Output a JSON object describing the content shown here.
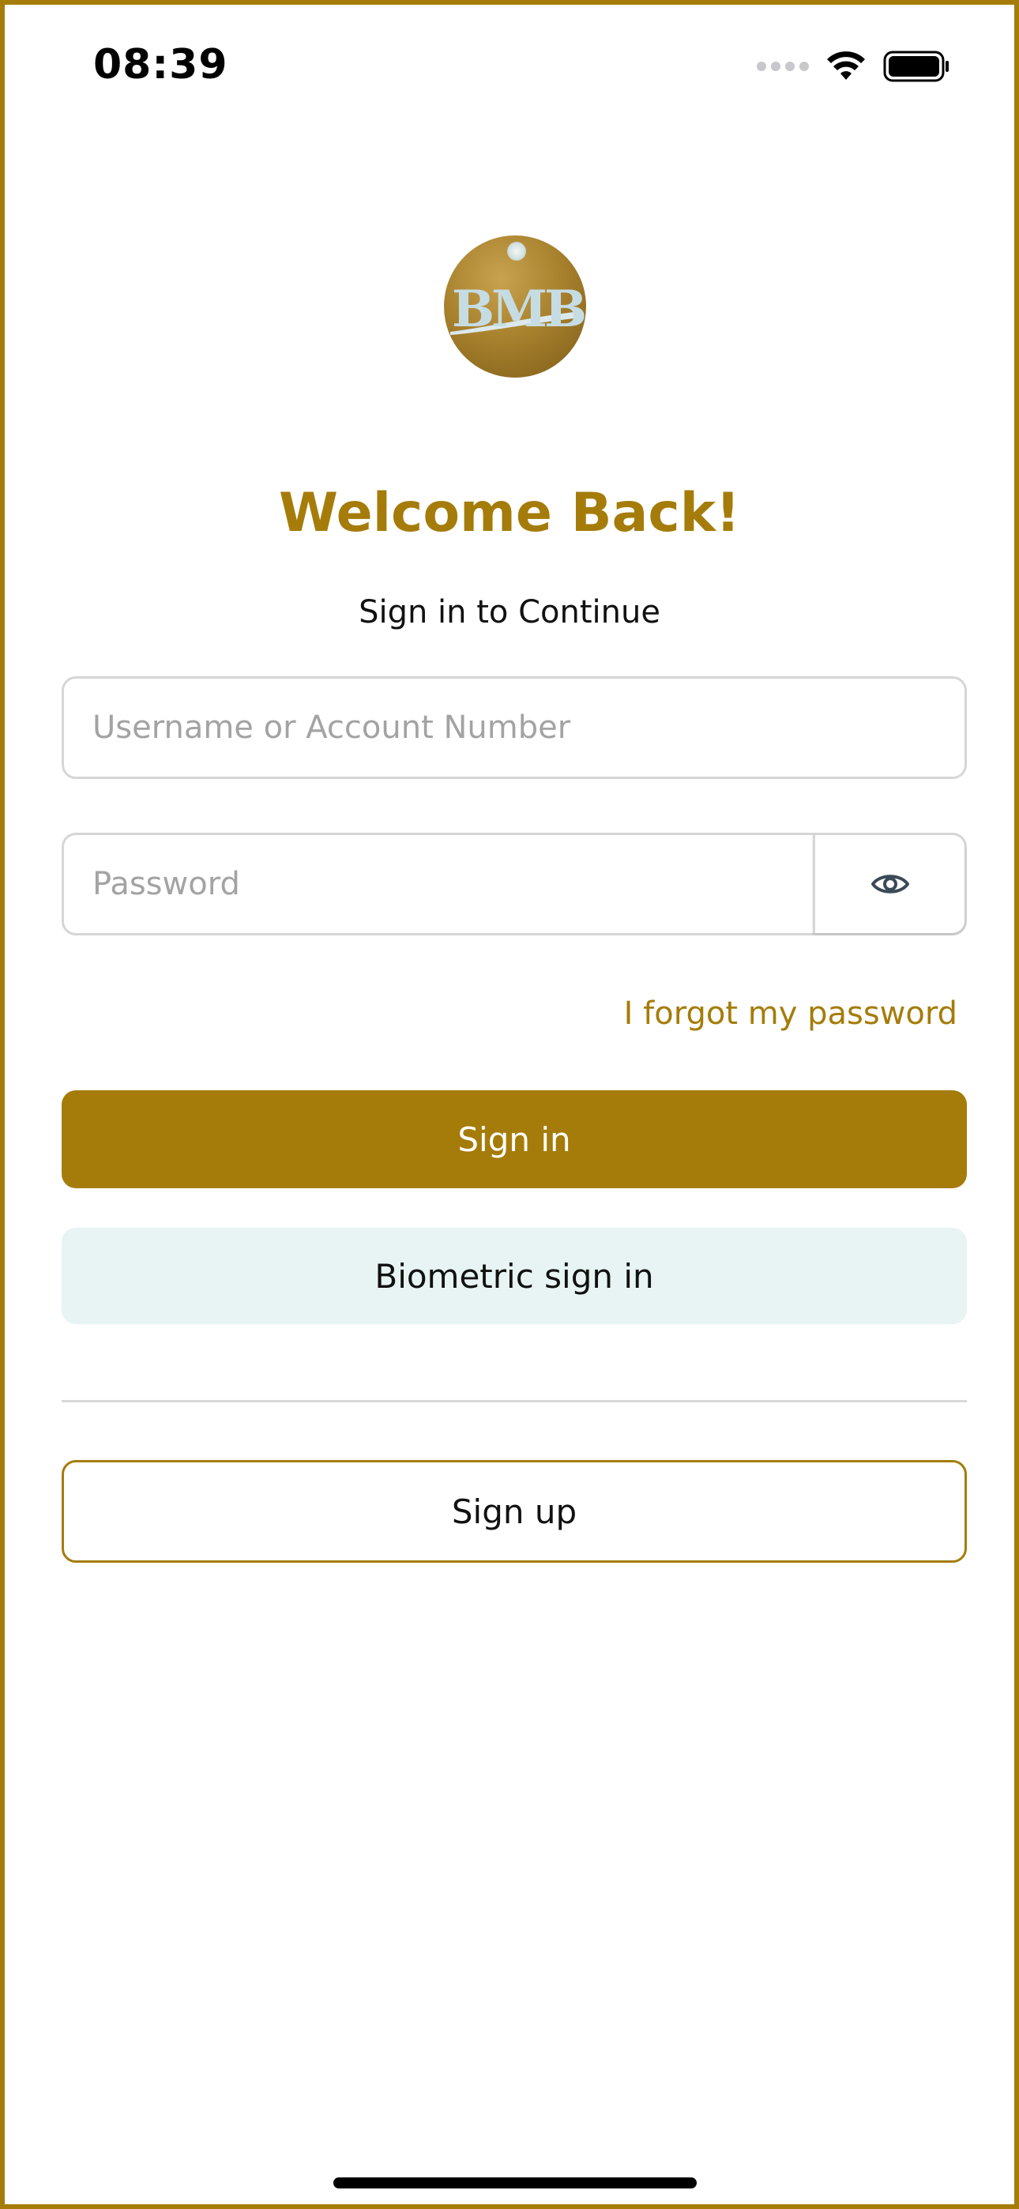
{
  "status_bar": {
    "time": "08:39",
    "icons": [
      "signal-icon",
      "wifi-icon",
      "battery-icon"
    ]
  },
  "logo": {
    "text": "BMB",
    "icon": "bank-logo"
  },
  "header": {
    "title": "Welcome Back!",
    "subtitle": "Sign in to Continue"
  },
  "form": {
    "username": {
      "value": "",
      "placeholder": "Username or Account Number"
    },
    "password": {
      "value": "",
      "placeholder": "Password",
      "toggle_icon": "eye-icon"
    },
    "forgot_label": "I forgot my password"
  },
  "actions": {
    "signin_label": "Sign in",
    "biometric_label": "Biometric sign in",
    "signup_label": "Sign up"
  },
  "colors": {
    "accent": "#a57c0a",
    "biometric_bg": "#e7f4f3",
    "border": "#d6d6d6",
    "placeholder": "#a3a3a3"
  }
}
